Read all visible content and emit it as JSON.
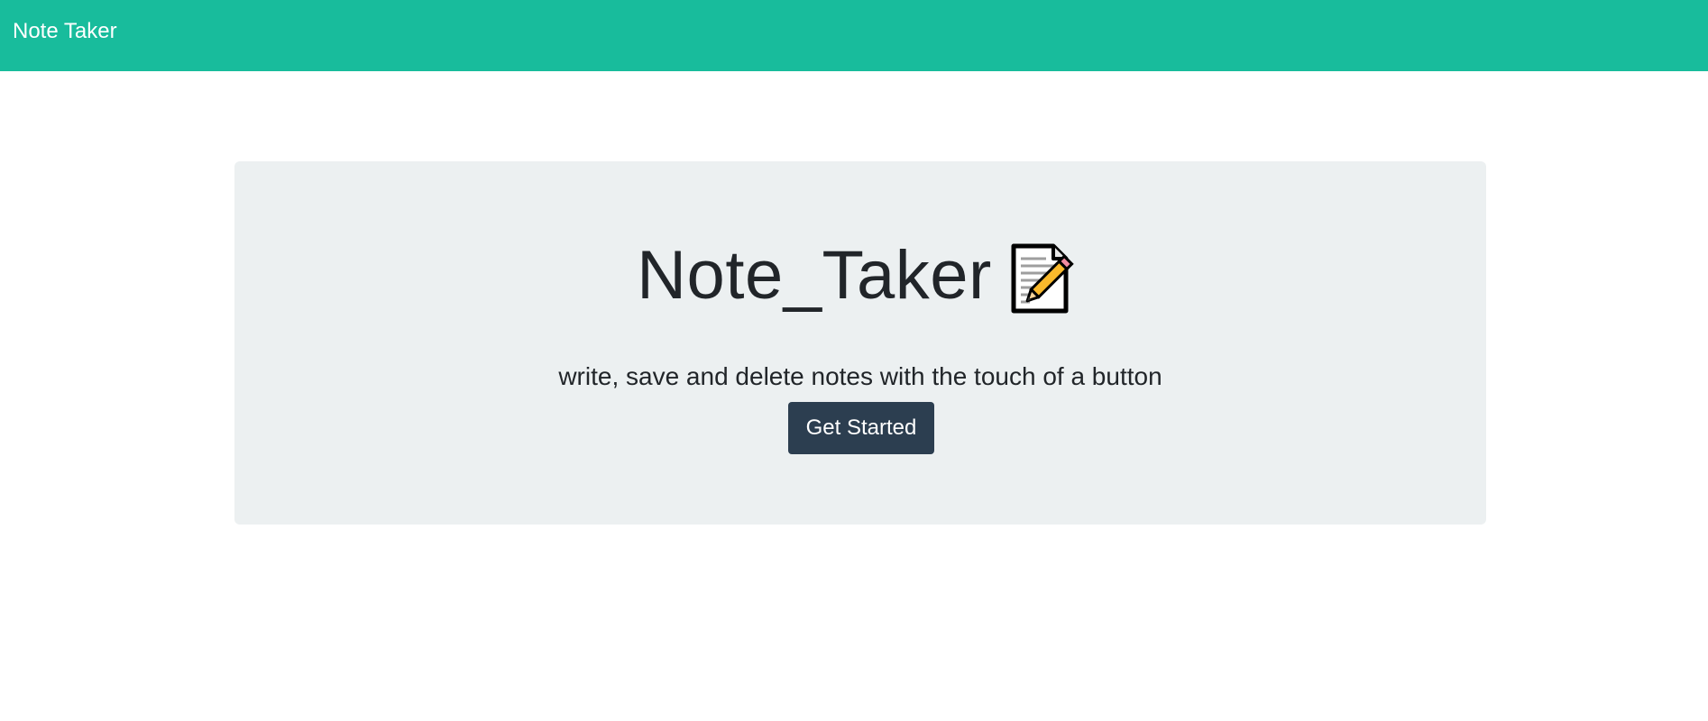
{
  "navbar": {
    "brand": "Note Taker",
    "background_color": "#18bc9c"
  },
  "hero": {
    "title": "Note_Taker",
    "title_icon": "memo-icon",
    "lead": "write, save and delete notes with the touch of a button",
    "button_label": "Get Started",
    "button_color": "#2c3e50",
    "background_color": "#ecf0f1"
  }
}
